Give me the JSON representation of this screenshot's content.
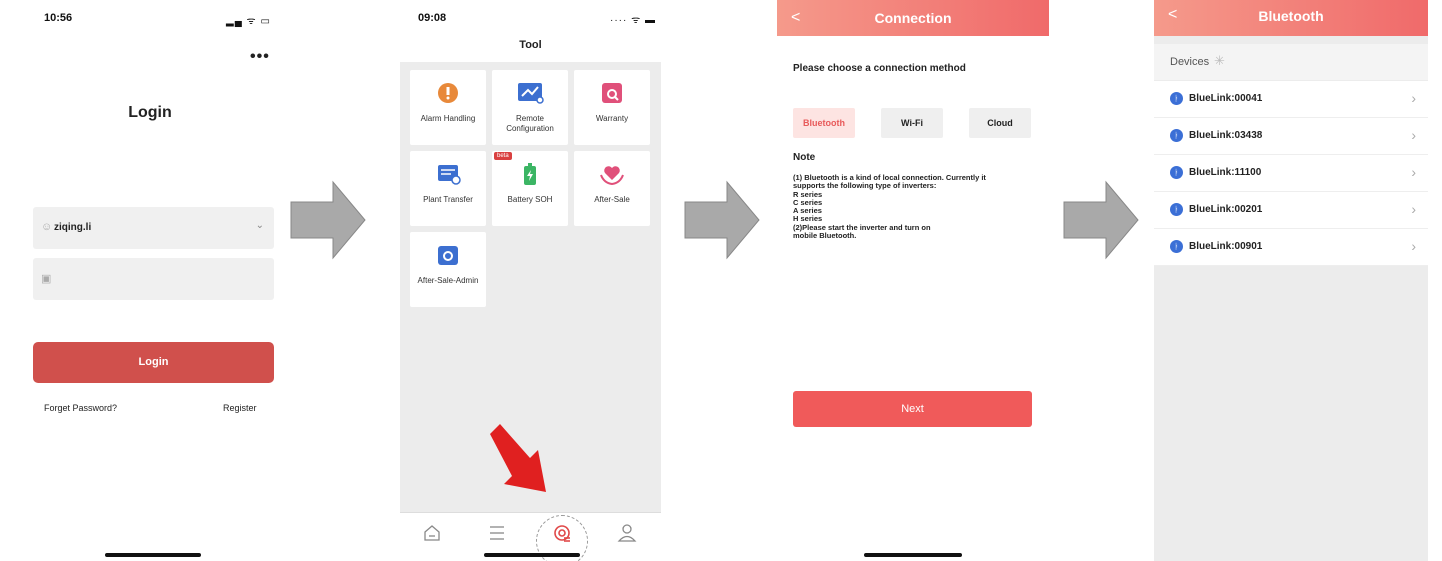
{
  "login_screen": {
    "status_time": "10:56",
    "status_icons": "▂▄ ᯤ ▭",
    "more_label": "•••",
    "title": "Login",
    "username_value": "ziqing.li",
    "password_value": "",
    "login_button": "Login",
    "forget_password": "Forget Password?",
    "register": "Register"
  },
  "tool_screen": {
    "status_time": "09:08",
    "status_icons": "···· ᯤ ▬",
    "title": "Tool",
    "tiles": [
      {
        "label": "Alarm Handling",
        "icon": "alarm-icon",
        "color": "#e8893a"
      },
      {
        "label": "Remote Configuration",
        "icon": "remote-config-icon",
        "color": "#3c6fd0"
      },
      {
        "label": "Warranty",
        "icon": "warranty-icon",
        "color": "#e0507a"
      },
      {
        "label": "Plant Transfer",
        "icon": "plant-transfer-icon",
        "color": "#3c6fd0"
      },
      {
        "label": "Battery SOH",
        "icon": "battery-icon",
        "color": "#3bb564"
      },
      {
        "label": "After-Sale",
        "icon": "after-sale-icon",
        "color": "#e0507a"
      },
      {
        "label": "After-Sale-Admin",
        "icon": "after-sale-admin-icon",
        "color": "#3c6fd0"
      }
    ],
    "beta_badge": "beta",
    "tabs": [
      "home-tab-icon",
      "list-tab-icon",
      "tool-tab-icon",
      "profile-tab-icon"
    ]
  },
  "connection_screen": {
    "title": "Connection",
    "choose_label": "Please choose a connection method",
    "options": [
      {
        "label": "Bluetooth",
        "selected": true
      },
      {
        "label": "Wi-Fi",
        "selected": false
      },
      {
        "label": "Cloud",
        "selected": false
      }
    ],
    "note_title": "Note",
    "note_lines": [
      "(1) Bluetooth is a kind of local connection. Currently it",
      "supports the following type of inverters:",
      "R series",
      "C series",
      "A series",
      "H series",
      "(2)Please start the inverter and turn on",
      "mobile Bluetooth."
    ],
    "next_button": "Next"
  },
  "bluetooth_screen": {
    "title": "Bluetooth",
    "devices_label": "Devices",
    "devices": [
      "BlueLink:00041",
      "BlueLink:03438",
      "BlueLink:11100",
      "BlueLink:00201",
      "BlueLink:00901"
    ]
  },
  "colors": {
    "login_red": "#d0504c",
    "header_gradient_start": "#f59a8b",
    "header_gradient_end": "#f06a6a",
    "next_red": "#f05a5a",
    "bluetooth_blue": "#3b6fd6",
    "arrow_gray": "#a9a9a9",
    "pointer_red": "#e02020"
  }
}
